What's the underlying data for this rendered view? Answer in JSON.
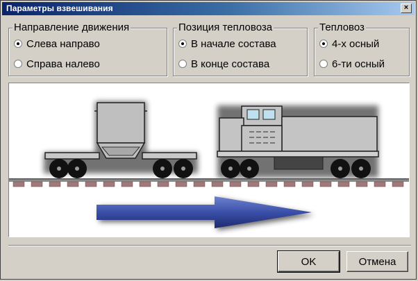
{
  "window": {
    "title": "Параметры взвешивания",
    "close_glyph": "×"
  },
  "groups": {
    "direction": {
      "legend": "Направление движения",
      "options": [
        {
          "label": "Слева направо",
          "selected": true
        },
        {
          "label": "Справа налево",
          "selected": false
        }
      ]
    },
    "position": {
      "legend": "Позиция тепловоза",
      "options": [
        {
          "label": "В начале состава",
          "selected": true
        },
        {
          "label": "В конце состава",
          "selected": false
        }
      ]
    },
    "locomotive": {
      "legend": "Тепловоз",
      "options": [
        {
          "label": "4-х осный",
          "selected": true
        },
        {
          "label": "6-ти осный",
          "selected": false
        }
      ]
    }
  },
  "preview": {
    "direction_arrow": "right",
    "arrow_color": "#3a4fa8",
    "rail_tie_color": "#a07a7a"
  },
  "buttons": {
    "ok": "OK",
    "cancel": "Отмена"
  }
}
